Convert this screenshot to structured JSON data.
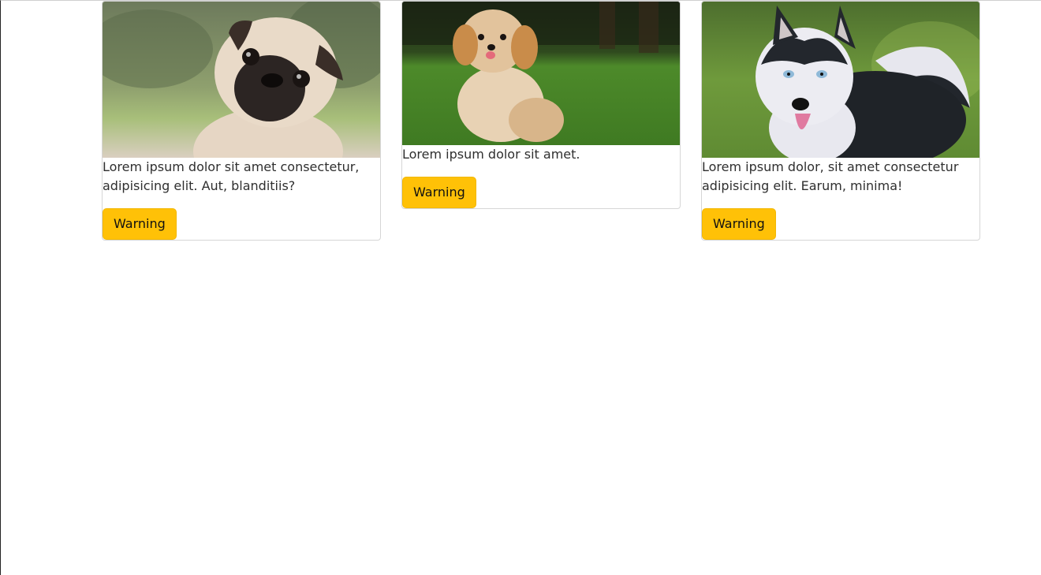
{
  "cards": [
    {
      "image_alt": "pug puppy",
      "text": "Lorem ipsum dolor sit amet consectetur, adipisicing elit. Aut, blanditiis?",
      "button_label": "Warning"
    },
    {
      "image_alt": "fluffy puppy on grass",
      "text": "Lorem ipsum dolor sit amet.",
      "button_label": "Warning"
    },
    {
      "image_alt": "husky dog",
      "text": "Lorem ipsum dolor, sit amet consectetur adipisicing elit. Earum, minima!",
      "button_label": "Warning"
    }
  ],
  "colors": {
    "button_bg": "#ffc107",
    "card_border": "#d6d6d6",
    "text": "#2f2f2f"
  }
}
